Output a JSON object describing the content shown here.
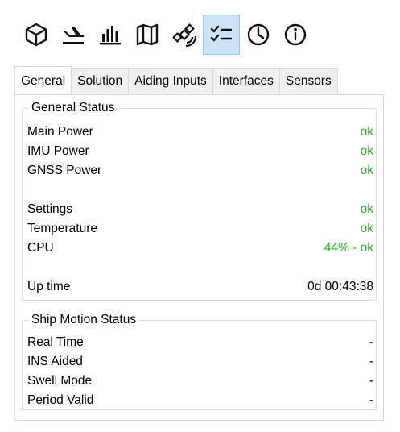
{
  "toolbar": {
    "icons": [
      "cube-icon",
      "plane-icon",
      "bar-chart-icon",
      "map-icon",
      "satellite-icon",
      "checklist-icon",
      "clock-icon",
      "info-icon"
    ],
    "active_index": 5
  },
  "tabs": [
    {
      "label": "General",
      "active": true
    },
    {
      "label": "Solution",
      "active": false
    },
    {
      "label": "Aiding Inputs",
      "active": false
    },
    {
      "label": "Interfaces",
      "active": false
    },
    {
      "label": "Sensors",
      "active": false
    }
  ],
  "general_status": {
    "title": "General Status",
    "rows": [
      {
        "label": "Main Power",
        "value": "ok"
      },
      {
        "label": "IMU Power",
        "value": "ok"
      },
      {
        "label": "GNSS Power",
        "value": "ok"
      },
      {
        "label": "Settings",
        "value": "ok"
      },
      {
        "label": "Temperature",
        "value": "ok"
      },
      {
        "label": "CPU",
        "value": "44% - ok"
      },
      {
        "label": "Up time",
        "value": "0d 00:43:38"
      }
    ]
  },
  "ship_motion_status": {
    "title": "Ship Motion Status",
    "rows": [
      {
        "label": "Real Time",
        "value": "-"
      },
      {
        "label": "INS Aided",
        "value": "-"
      },
      {
        "label": "Swell Mode",
        "value": "-"
      },
      {
        "label": "Period Valid",
        "value": "-"
      }
    ]
  },
  "colors": {
    "ok": "#22b822",
    "active_toolbar_bg": "#cce4f7"
  }
}
